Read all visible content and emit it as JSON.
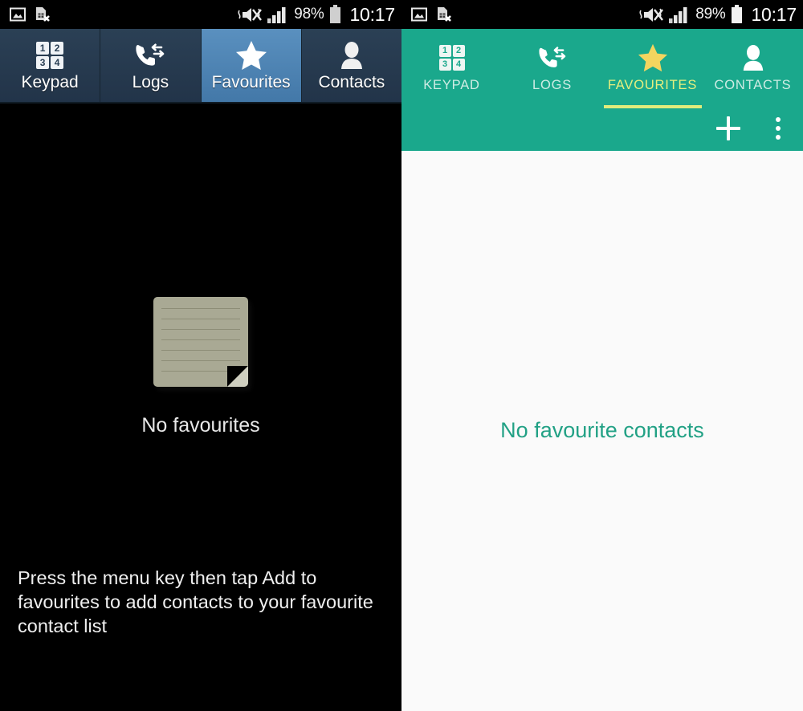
{
  "left_screen": {
    "theme_name": "samsung-touchwiz-dark",
    "colors": {
      "background": "#000000",
      "tab_bar": "#24384b",
      "tab_selected": "#4a82b3",
      "text": "#ffffff"
    },
    "status_bar": {
      "icons": [
        "image-icon",
        "sim-card-error-icon",
        "vibrate-mute-icon",
        "signal-bars-icon",
        "battery-icon"
      ],
      "battery_percent": "98%",
      "time": "10:17"
    },
    "tabs": [
      {
        "label": "Keypad",
        "icon": "keypad-icon",
        "selected": false
      },
      {
        "label": "Logs",
        "icon": "call-logs-icon",
        "selected": false
      },
      {
        "label": "Favourites",
        "icon": "star-icon",
        "selected": true
      },
      {
        "label": "Contacts",
        "icon": "person-icon",
        "selected": false
      }
    ],
    "keypad_digits": [
      "1",
      "2",
      "3",
      "4"
    ],
    "empty_state": {
      "illustration": "lined-note-icon",
      "title": "No favourites",
      "hint": "Press the menu key then tap Add to favourites to add contacts to your favourite contact list"
    }
  },
  "right_screen": {
    "theme_name": "material-teal",
    "colors": {
      "background": "#fafafa",
      "app_bar": "#1aa88c",
      "accent": "#e0ec7c",
      "empty_text": "#22a185"
    },
    "status_bar": {
      "icons": [
        "image-icon",
        "sim-card-error-icon",
        "vibrate-mute-icon",
        "signal-bars-icon",
        "battery-icon"
      ],
      "battery_percent": "89%",
      "time": "10:17"
    },
    "tabs": [
      {
        "label": "KEYPAD",
        "icon": "keypad-icon",
        "selected": false
      },
      {
        "label": "LOGS",
        "icon": "call-logs-icon",
        "selected": false
      },
      {
        "label": "FAVOURITES",
        "icon": "star-icon",
        "selected": true
      },
      {
        "label": "CONTACTS",
        "icon": "person-icon",
        "selected": false
      }
    ],
    "keypad_digits": [
      "1",
      "2",
      "3",
      "4"
    ],
    "actions": [
      {
        "name": "add-button",
        "icon": "plus-icon"
      },
      {
        "name": "overflow-menu-button",
        "icon": "more-vertical-icon"
      }
    ],
    "empty_state": {
      "title": "No favourite contacts"
    }
  }
}
